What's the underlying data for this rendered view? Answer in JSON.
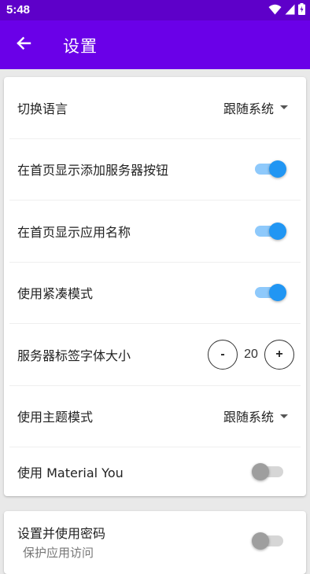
{
  "status_bar": {
    "time": "5:48",
    "icons": [
      "wifi-icon",
      "signal-icon",
      "battery-charging-icon"
    ]
  },
  "app_bar": {
    "title": "设置",
    "back_icon": "arrow-left-icon",
    "background": "#6a00e8"
  },
  "settings": {
    "language": {
      "label": "切换语言",
      "value": "跟随系统"
    },
    "show_add_server_button": {
      "label": "在首页显示添加服务器按钮",
      "on": true
    },
    "show_app_name": {
      "label": "在首页显示应用名称",
      "on": true
    },
    "compact_mode": {
      "label": "使用紧凑模式",
      "on": true
    },
    "server_label_font_size": {
      "label": "服务器标签字体大小",
      "decrement": "-",
      "value": "20",
      "increment": "+"
    },
    "theme_mode": {
      "label": "使用主题模式",
      "value": "跟随系统"
    },
    "material_you": {
      "label": "使用 Material You",
      "on": false
    }
  },
  "security": {
    "password": {
      "label": "设置并使用密码",
      "sublabel": "保护应用访问",
      "on": false
    }
  },
  "colors": {
    "accent": "#2196f3",
    "switch_track_on": "#8ec9fb",
    "status_bar": "#5e00c9"
  }
}
